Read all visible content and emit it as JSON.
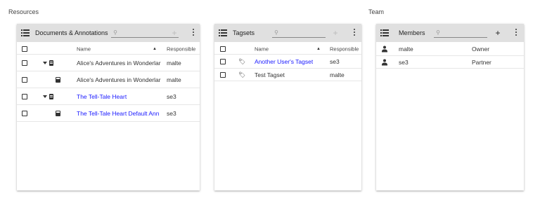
{
  "sections": {
    "resources": "Resources",
    "team": "Team"
  },
  "documents": {
    "title": "Documents & Annotations",
    "search_placeholder": "",
    "add_label": "+",
    "columns": {
      "name": "Name",
      "responsible": "Responsible"
    },
    "rows": [
      {
        "name": "Alice's Adventures in Wonderlar",
        "responsible": "malte"
      },
      {
        "name": "Alice's Adventures in Wonderlar",
        "responsible": "malte"
      },
      {
        "name": "The Tell-Tale Heart",
        "responsible": "se3"
      },
      {
        "name": "The Tell-Tale Heart Default Ann",
        "responsible": "se3"
      }
    ]
  },
  "tagsets": {
    "title": "Tagsets",
    "search_placeholder": "",
    "add_label": "+",
    "columns": {
      "name": "Name",
      "responsible": "Responsible"
    },
    "rows": [
      {
        "name": "Another User's Tagset",
        "responsible": "se3"
      },
      {
        "name": "Test Tagset",
        "responsible": "malte"
      }
    ]
  },
  "members": {
    "title": "Members",
    "search_placeholder": "",
    "add_label": "+",
    "rows": [
      {
        "name": "malte",
        "role": "Owner"
      },
      {
        "name": "se3",
        "role": "Partner"
      }
    ]
  },
  "icons": {
    "list": "list-icon",
    "search": "search-icon",
    "more": "more-vert-icon",
    "document": "document-icon",
    "annotation": "annotation-icon",
    "expand": "caret-down-icon",
    "tag": "tag-icon",
    "person": "person-icon",
    "sort": "sort-asc-icon"
  }
}
